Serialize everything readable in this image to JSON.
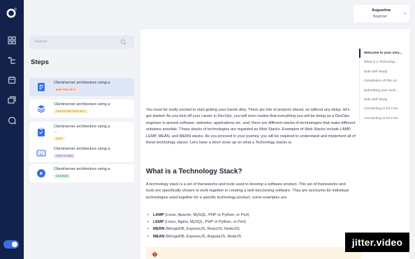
{
  "header": {
    "user_name": "Augustina",
    "user_level": "Beginner"
  },
  "sidebar": {
    "rail_icons": [
      "logo-icon",
      "dashboard-icon",
      "roadmap-icon",
      "calendar-icon",
      "projects-icon",
      "chat-icon"
    ],
    "theme_toggle": "on"
  },
  "steps_panel": {
    "search_placeholder": "Search",
    "title": "Steps",
    "steps": [
      {
        "title": "Client/server architecture using a",
        "badge": "MINI PROJECT",
        "icon": "document-icon",
        "active": true
      },
      {
        "title": "Client/server architecture using a",
        "badge": "CAPSTONE PROJECT",
        "icon": "layers-icon"
      },
      {
        "title": "Client/server architecture using a",
        "title2": "...",
        "badge": "QUIZ",
        "icon": "quiz-icon"
      },
      {
        "title": "Client/server architecture using a",
        "badge": "LIVE CLASS",
        "icon": "keyboard-icon"
      },
      {
        "title": "Client/server architecture using a",
        "badge": "COURSE",
        "icon": "play-icon"
      }
    ]
  },
  "content": {
    "intro": "You must be really excited to start getting your hands dirty. There are lots of projects ahead, so without any delay, let's get started. As you kick off your career in DevOps, you will soon realise that everything you will be doing as a DevOps engineer is around software, websites, applications etc, and, there are different stacks of technologies that make different solutions possible. These stacks of technologies are regarded as Web Stacks. Examples of Web Stacks include LAMP, LEMP, MEAN, and MERN stacks. As you proceed in your journey, you will be required to understand and implement all of these technology stacks. Let's have a short close up on what a Technology stacks is.",
    "heading": "What is a Technology Stack?",
    "para": "A technology stack is a set of frameworks and tools used to develop a software product. This set of frameworks and tools are specifically chosen to work together in creating a well-functioning software. They are acronyms for individual technologies used together for a specific technology product. some examples are:",
    "stacks": [
      {
        "name": "LAMP",
        "detail": " (Linux, Apache, MySQL, PHP or Python, or Perl)"
      },
      {
        "name": "LEMP",
        "detail": " (Linux, Nginx, MySQL, PHP or Python, or Perl)"
      },
      {
        "name": "MERN",
        "detail": " (MongoDB, ExpressJS, ReactJS, NodeJS)"
      },
      {
        "name": "MEAN",
        "detail": " (MongoDB, ExpressJS, AngularJS, NodeJS"
      }
    ]
  },
  "toc": {
    "items": [
      "Welcome to your very...",
      "What is a Technolog...",
      "Side Self Study",
      "Completion of PEL pr...",
      "Submitting your work...",
      "Side Self Study",
      "Connecting to EC2 ter...",
      "Connecting to EC2 ter..."
    ]
  },
  "watermark": "jitter.video",
  "colors": {
    "rail": "#13224a",
    "accent": "#3b6fe0",
    "page_bg": "#f1f3f6",
    "active_step": "#dfe6f6"
  }
}
